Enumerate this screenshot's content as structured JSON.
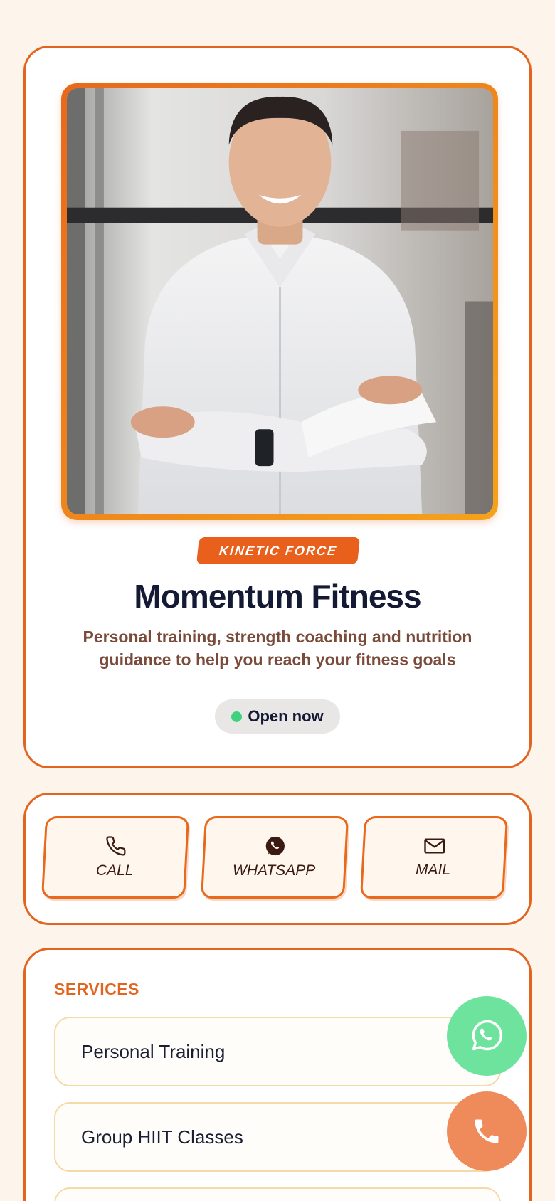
{
  "hero": {
    "tag": "KINETIC FORCE",
    "title": "Momentum Fitness",
    "description": "Personal training, strength coaching and nutrition guidance to help you reach your fitness goals",
    "status": "Open now",
    "status_color": "#3fd27c"
  },
  "actions": [
    {
      "label": "CALL",
      "icon": "phone-icon"
    },
    {
      "label": "WHATSAPP",
      "icon": "whatsapp-icon"
    },
    {
      "label": "MAIL",
      "icon": "mail-icon"
    }
  ],
  "services": {
    "heading": "SERVICES",
    "items": [
      "Personal Training",
      "Group HIIT Classes",
      ""
    ]
  },
  "fabs": {
    "whatsapp_icon": "whatsapp-icon",
    "call_icon": "phone-icon"
  },
  "colors": {
    "accent": "#e2651f",
    "background": "#fdf4ec",
    "whatsapp_fab": "#6ee39d",
    "call_fab": "#ef8a5b"
  }
}
